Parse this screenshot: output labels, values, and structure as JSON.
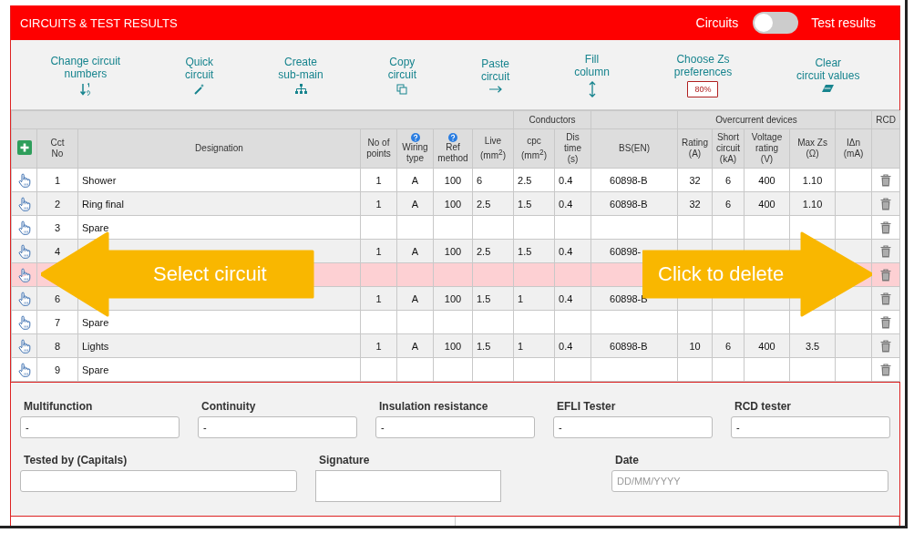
{
  "header": {
    "title": "CIRCUITS & TEST RESULTS",
    "toggle_left": "Circuits",
    "toggle_right": "Test results",
    "toggle_on": false
  },
  "toolbar": [
    {
      "label": "Change circuit\nnumbers"
    },
    {
      "label": "Quick\ncircuit"
    },
    {
      "label": "Create\nsub-main"
    },
    {
      "label": "Copy\ncircuit"
    },
    {
      "label": "Paste\ncircuit"
    },
    {
      "label": "Fill\ncolumn"
    },
    {
      "label": "Choose Zs\npreferences",
      "badge": "80%"
    },
    {
      "label": "Clear\ncircuit values"
    }
  ],
  "table": {
    "groups": [
      "Conductors",
      "Overcurrent devices",
      "RCD"
    ],
    "columns": [
      {
        "label": "Cct\nNo",
        "help": false
      },
      {
        "label": "Designation",
        "help": false
      },
      {
        "label": "No of\npoints",
        "help": false
      },
      {
        "label": "Wiring\ntype",
        "help": true
      },
      {
        "label": "Ref\nmethod",
        "help": true
      },
      {
        "label": "Live\n(mm$^{2}$)",
        "help": false
      },
      {
        "label": "cpc\n(mm$^{2}$)",
        "help": false
      },
      {
        "label": "Dis\ntime\n(s)",
        "help": false
      },
      {
        "label": "BS(EN)",
        "help": false
      },
      {
        "label": "Rating\n(A)",
        "help": false
      },
      {
        "label": "Short\ncircuit\n(kA)",
        "help": false
      },
      {
        "label": "Voltage\nrating\n(V)",
        "help": false
      },
      {
        "label": "Max Zs\n(Ω)",
        "help": false
      },
      {
        "label": "IΔn\n(mA)",
        "help": false
      }
    ],
    "rows": [
      {
        "selected": false,
        "cells": [
          "1",
          "Shower",
          "1",
          "A",
          "100",
          "6",
          "2.5",
          "0.4",
          "60898-B",
          "32",
          "6",
          "400",
          "1.10",
          null
        ]
      },
      {
        "selected": false,
        "cells": [
          "2",
          "Ring final",
          "1",
          "A",
          "100",
          "2.5",
          "1.5",
          "0.4",
          "60898-B",
          "32",
          "6",
          "400",
          "1.10",
          null
        ]
      },
      {
        "selected": false,
        "cells": [
          "3",
          "Spare",
          null,
          null,
          null,
          null,
          null,
          null,
          null,
          null,
          null,
          null,
          null,
          null
        ]
      },
      {
        "selected": false,
        "cells": [
          "4",
          null,
          "1",
          "A",
          "100",
          "2.5",
          "1.5",
          "0.4",
          "60898-",
          null,
          null,
          null,
          null,
          null
        ]
      },
      {
        "selected": true,
        "cells": [
          null,
          null,
          null,
          null,
          null,
          null,
          null,
          null,
          null,
          null,
          null,
          null,
          null,
          null
        ]
      },
      {
        "selected": false,
        "cells": [
          "6",
          null,
          "1",
          "A",
          "100",
          "1.5",
          "1",
          "0.4",
          "60898-B",
          null,
          null,
          null,
          null,
          null
        ]
      },
      {
        "selected": false,
        "cells": [
          "7",
          "Spare",
          null,
          null,
          null,
          null,
          null,
          null,
          null,
          null,
          null,
          null,
          null,
          null
        ]
      },
      {
        "selected": false,
        "cells": [
          "8",
          "Lights",
          "1",
          "A",
          "100",
          "1.5",
          "1",
          "0.4",
          "60898-B",
          "10",
          "6",
          "400",
          "3.5",
          null
        ]
      },
      {
        "selected": false,
        "cells": [
          "9",
          "Spare",
          null,
          null,
          null,
          null,
          null,
          null,
          null,
          null,
          null,
          null,
          null,
          null
        ]
      }
    ]
  },
  "callouts": [
    {
      "text": "Select circuit"
    },
    {
      "text": "Click to delete"
    }
  ],
  "instruments": [
    {
      "label": "Multifunction",
      "value": "-"
    },
    {
      "label": "Continuity",
      "value": "-"
    },
    {
      "label": "Insulation resistance",
      "value": "-"
    },
    {
      "label": "EFLI Tester",
      "value": "-"
    },
    {
      "label": "RCD tester",
      "value": "-"
    }
  ],
  "signoff": [
    {
      "label": "Tested by (Capitals)",
      "kind": "text"
    },
    {
      "label": "Signature",
      "kind": "signature"
    },
    {
      "label": "Date",
      "kind": "date",
      "placeholder": "DD/MM/YYYY"
    }
  ]
}
